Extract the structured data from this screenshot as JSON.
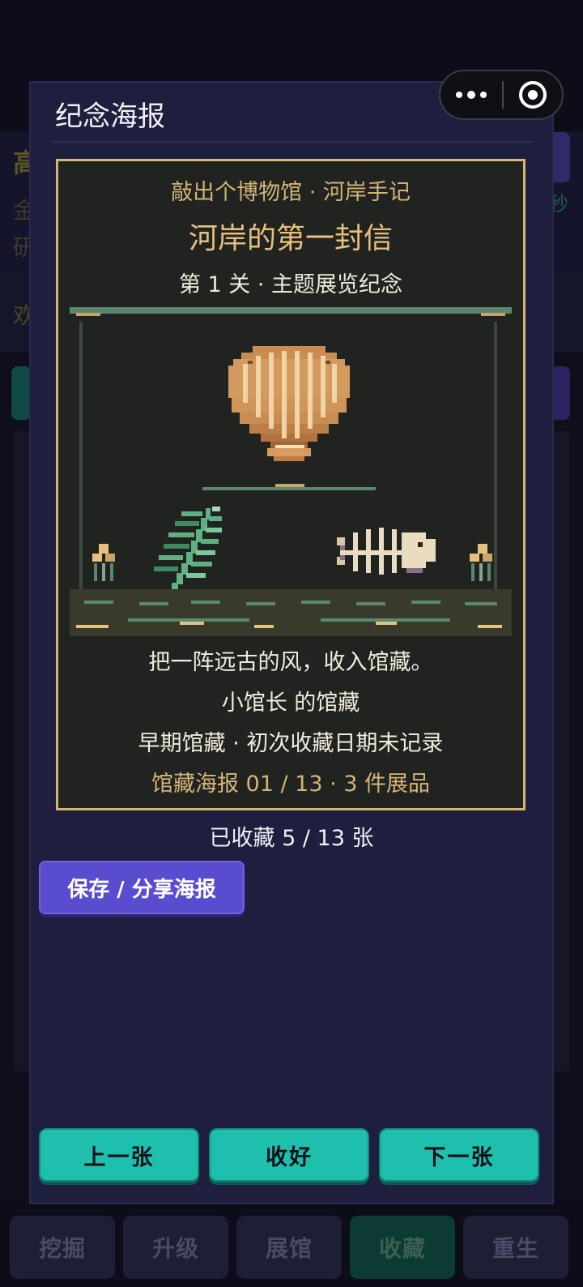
{
  "background": {
    "fragments": [
      "高",
      "金",
      "研",
      "欢"
    ],
    "side_text": "秒"
  },
  "bottom_nav": [
    {
      "label": "挖掘",
      "active": false
    },
    {
      "label": "升级",
      "active": false
    },
    {
      "label": "展馆",
      "active": false
    },
    {
      "label": "收藏",
      "active": true
    },
    {
      "label": "重生",
      "active": false
    }
  ],
  "capsule": {
    "more_icon": "more-dots-icon",
    "close_icon": "target-close-icon"
  },
  "modal": {
    "title": "纪念海报",
    "poster": {
      "subtitle": "敲出个博物馆 · 河岸手记",
      "title": "河岸的第一封信",
      "level": "第 1 关 · 主题展览纪念",
      "art_icons": [
        "scallop-shell-icon",
        "fern-fossil-icon",
        "fish-skeleton-icon",
        "pebble-stack-icon"
      ],
      "quote": "把一阵远古的风，收入馆藏。",
      "owner": "小馆长 的馆藏",
      "date_line": "早期馆藏 · 初次收藏日期未记录",
      "footer": "馆藏海报 01 / 13 · 3 件展品"
    },
    "collected": "已收藏 5 / 13 张",
    "save_button": "保存 / 分享海报",
    "actions": {
      "prev": "上一张",
      "close": "收好",
      "next": "下一张"
    }
  },
  "colors": {
    "modal_bg": "#1e1e3e",
    "poster_border": "#d4b577",
    "accent_teal": "#1fbfad",
    "accent_purple": "#5a4ccf"
  }
}
